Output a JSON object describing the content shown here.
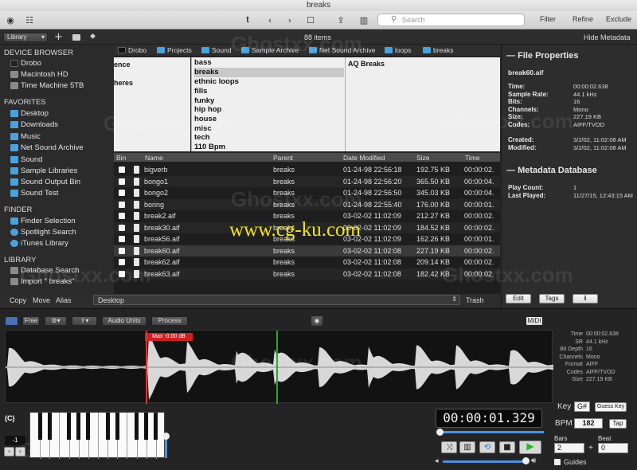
{
  "window": {
    "title": "breaks"
  },
  "toolbar": {
    "search_placeholder": "Search",
    "filter": "Filter",
    "refine": "Refine",
    "exclude": "Exclude",
    "tool_t": "t"
  },
  "row2": {
    "library_select": "Library",
    "item_count": "88 items",
    "hide_metadata": "Hide Metadata"
  },
  "sidebar": {
    "device_header": "DEVICE BROWSER",
    "devices": [
      "Drobo",
      "Macintosh HD",
      "Time Machine 5TB"
    ],
    "favorites_header": "FAVORITES",
    "favorites": [
      "Desktop",
      "Downloads",
      "Music",
      "Net Sound Archive",
      "Sound",
      "Sample Libraries",
      "Sound Output Bin",
      "Sound Test"
    ],
    "finder_header": "FINDER",
    "finder": [
      "Finder Selection",
      "Spotlight Search",
      "iTunes Library"
    ],
    "library_header": "LIBRARY",
    "library": [
      "Database Search",
      "Import \" breaks\""
    ]
  },
  "path": [
    "Drobo",
    "Projects",
    "Sound",
    "Sample Archive",
    "Net Sound Archive",
    "loops",
    "breaks"
  ],
  "columns": {
    "col1": [
      "ence",
      "heres"
    ],
    "col2": [
      "bass",
      "breaks",
      "ethnic loops",
      "fills",
      "funky",
      "hip hop",
      "house",
      "misc",
      "tech",
      "110 Bpm"
    ],
    "col2_selected": 1,
    "col3": [
      "AQ Breaks"
    ]
  },
  "table": {
    "headers": [
      "Bin",
      "Name",
      "Parent",
      "Date Modified",
      "Size",
      "Time"
    ],
    "rows": [
      [
        "bigverb",
        "breaks",
        "01-24-98 22:56:18",
        "192.75 KB",
        "00:00:02."
      ],
      [
        "bongo1",
        "breaks",
        "01-24-98 22:56:20",
        "365.50 KB",
        "00:00:04."
      ],
      [
        "bongo2",
        "breaks",
        "01-24-98 22:56:50",
        "345.03 KB",
        "00:00:04."
      ],
      [
        "boring",
        "breaks",
        "01-24-98 22:55:40",
        "176.00 KB",
        "00:00:01."
      ],
      [
        "break2.aif",
        "breaks",
        "03-02-02 11:02:09",
        "212.27 KB",
        "00:00:02."
      ],
      [
        "break30.aif",
        "breaks",
        "03-02-02 11:02:09",
        "184.52 KB",
        "00:00:02."
      ],
      [
        "break56.aif",
        "breaks",
        "03-02-02 11:02:09",
        "162.26 KB",
        "00:00:01."
      ],
      [
        "break60.aif",
        "breaks",
        "03-02-02 11:02:08",
        "227.19 KB",
        "00:00:02."
      ],
      [
        "break62.aif",
        "breaks",
        "03-02-02 11:02:08",
        "209.14 KB",
        "00:00:02."
      ],
      [
        "break63.aif",
        "breaks",
        "03-02-02 11:02:08",
        "182.42 KB",
        "00:00:02."
      ]
    ],
    "selected_row": 7
  },
  "copybar": {
    "copy": "Copy",
    "move": "Move",
    "alias": "Alias",
    "destination": "Desktop",
    "trash": "Trash"
  },
  "properties": {
    "header": "File Properties",
    "filename": "break60.aif",
    "fields": [
      {
        "label": "Time:",
        "value": "00:00:02.638"
      },
      {
        "label": "Sample Rate:",
        "value": "44.1 kHz"
      },
      {
        "label": "Bits:",
        "value": "16"
      },
      {
        "label": "Channels:",
        "value": "Mono"
      },
      {
        "label": "Size:",
        "value": "227.19 KB"
      },
      {
        "label": "Codes:",
        "value": "AIFF/TVOD"
      }
    ],
    "dates": [
      {
        "label": "Created:",
        "value": "3/2/02, 11:02:08 AM"
      },
      {
        "label": "Modified:",
        "value": "3/2/02, 11:02:08 AM"
      }
    ],
    "db_header": "Metadata Database",
    "db": [
      {
        "label": "Play Count:",
        "value": "1"
      },
      {
        "label": "Last Played:",
        "value": "11/27/15, 12:43:15 AM"
      }
    ],
    "edit": "Edit",
    "tags": "Tags"
  },
  "player": {
    "free": "Free",
    "audio_units": "Audio Units",
    "process": "Process",
    "midi": "MIDI",
    "max_label": "Max -0.00 dB",
    "info": [
      {
        "label": "Time",
        "value": "00:00:02.638"
      },
      {
        "label": "SR",
        "value": "44.1 kHz"
      },
      {
        "label": "Bit Depth",
        "value": "16"
      },
      {
        "label": "Channels",
        "value": "Mono"
      },
      {
        "label": "Format",
        "value": "AIFF"
      },
      {
        "label": "Codes",
        "value": "AIFF/TVOD"
      },
      {
        "label": "Size",
        "value": "227.19 KB"
      }
    ],
    "key_label": "Key",
    "key_value": "G#",
    "guess_key": "Guess Key",
    "bpm_label": "BPM",
    "bpm_value": "182",
    "tap": "Tap",
    "time_display": "00:00:01.329",
    "bars_label": "Bars",
    "bars_value": "2",
    "beat_label": "Beat",
    "beat_value": "0",
    "guides": "Guides",
    "octave_label": "(C)",
    "octave_value": "-1"
  },
  "watermark": {
    "main": "www.cg-ku.com",
    "ghost": "Ghostxx.com"
  }
}
